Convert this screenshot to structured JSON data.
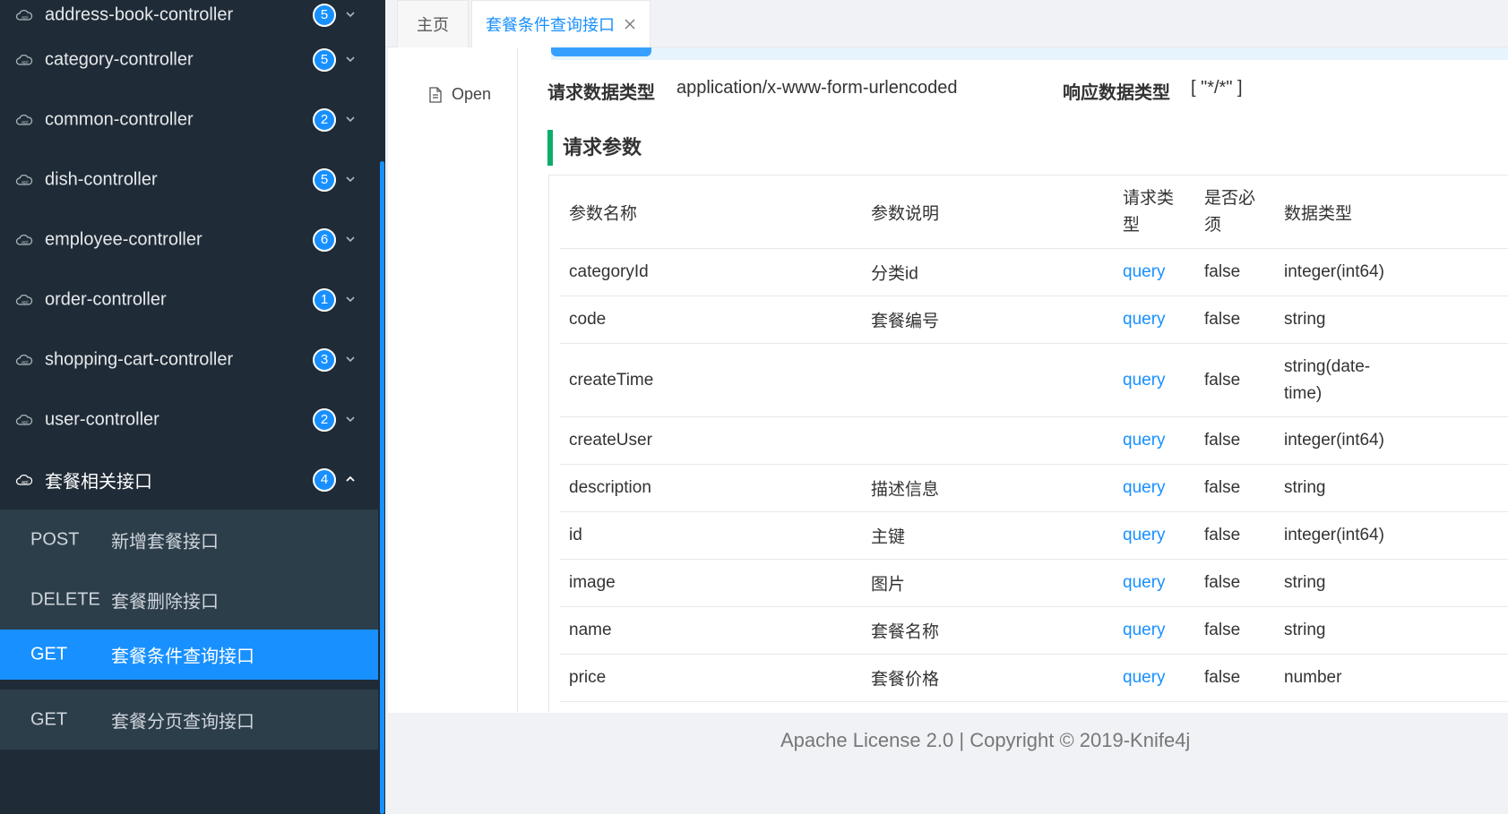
{
  "sidebar": {
    "groups": [
      {
        "label": "address-book-controller",
        "count": "5"
      },
      {
        "label": "category-controller",
        "count": "5"
      },
      {
        "label": "common-controller",
        "count": "2"
      },
      {
        "label": "dish-controller",
        "count": "5"
      },
      {
        "label": "employee-controller",
        "count": "6"
      },
      {
        "label": "order-controller",
        "count": "1"
      },
      {
        "label": "shopping-cart-controller",
        "count": "3"
      },
      {
        "label": "user-controller",
        "count": "2"
      },
      {
        "label": "套餐相关接口",
        "count": "4"
      }
    ],
    "endpoints": [
      {
        "method": "POST",
        "name": "新增套餐接口"
      },
      {
        "method": "DELETE",
        "name": "套餐删除接口"
      },
      {
        "method": "GET",
        "name": "套餐条件查询接口"
      },
      {
        "method": "GET",
        "name": "套餐分页查询接口"
      }
    ],
    "accent": "#1890ff"
  },
  "tabs": {
    "home": "主页",
    "current": "套餐条件查询接口"
  },
  "doc": {
    "open_label": "Open",
    "request_type_label": "请求数据类型",
    "request_type_value": "application/x-www-form-urlencoded",
    "response_type_label": "响应数据类型",
    "response_type_value": "[ \"*/*\" ]",
    "section_title": "请求参数"
  },
  "table": {
    "headers": [
      "参数名称",
      "参数说明",
      "请求类型",
      "是否必须",
      "数据类型"
    ],
    "header_lines": {
      "type_line1": "请求类",
      "type_line2": "型",
      "req_line1": "是否必",
      "req_line2": "须"
    },
    "rows": [
      {
        "name": "categoryId",
        "desc": "分类id",
        "in": "query",
        "required": "false",
        "type": "integer(int64)"
      },
      {
        "name": "code",
        "desc": "套餐编号",
        "in": "query",
        "required": "false",
        "type": "string"
      },
      {
        "name": "createTime",
        "desc": "",
        "in": "query",
        "required": "false",
        "type_line1": "string(date-",
        "type_line2": "time)"
      },
      {
        "name": "createUser",
        "desc": "",
        "in": "query",
        "required": "false",
        "type": "integer(int64)"
      },
      {
        "name": "description",
        "desc": "描述信息",
        "in": "query",
        "required": "false",
        "type": "string"
      },
      {
        "name": "id",
        "desc": "主键",
        "in": "query",
        "required": "false",
        "type": "integer(int64)"
      },
      {
        "name": "image",
        "desc": "图片",
        "in": "query",
        "required": "false",
        "type": "string"
      },
      {
        "name": "name",
        "desc": "套餐名称",
        "in": "query",
        "required": "false",
        "type": "string"
      },
      {
        "name": "price",
        "desc": "套餐价格",
        "in": "query",
        "required": "false",
        "type": "number"
      }
    ]
  },
  "footer": {
    "text": "Apache License 2.0 | Copyright © 2019-Knife4j"
  }
}
